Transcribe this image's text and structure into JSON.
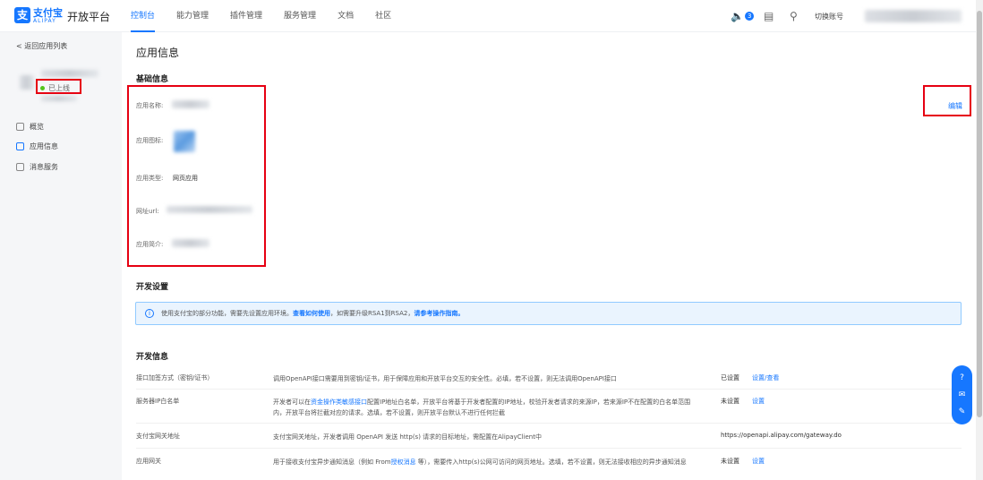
{
  "header": {
    "brand_glyph": "支",
    "brand_name": "支付宝",
    "brand_sub": "ALIPAY",
    "platform": "开放平台",
    "nav": [
      "控制台",
      "能力管理",
      "插件管理",
      "服务管理",
      "文档",
      "社区"
    ],
    "active_nav": "控制台",
    "notification_count": "3",
    "switch_account": "切换账号",
    "icons": [
      "speaker-icon",
      "document-icon",
      "search-icon"
    ]
  },
  "sidebar": {
    "back": "< 返回应用列表",
    "status": "已上线",
    "items": [
      "概览",
      "应用信息",
      "消息服务"
    ]
  },
  "main": {
    "title": "应用信息",
    "basic_title": "基础信息",
    "fields": {
      "name": "应用名称:",
      "icon": "应用图标:",
      "type": "应用类型:",
      "type_value": "网页应用",
      "url": "网址url:",
      "intro": "应用简介:"
    },
    "edit": "编辑",
    "dev_settings_title": "开发设置",
    "notice": {
      "text1": "使用支付宝的部分功能，需要先设置应用环境。",
      "link1": "查看如何使用",
      "text2": "，如需要升级RSA1到RSA2，",
      "link2": "请参考操作指南。"
    },
    "dev_info_title": "开发信息",
    "rows": [
      {
        "label": "接口加签方式（密钥/证书）",
        "desc": "调用OpenAPI接口需要用到密钥/证书，用于保障应用和开放平台交互的安全性。必填，若不设置，则无法调用OpenAPI接口",
        "status": "已设置",
        "action": "设置/查看"
      },
      {
        "label": "服务器IP白名单",
        "desc_pre": "开发者可以在",
        "desc_link": "资金操作类敏感接口",
        "desc_post": "配置IP地址白名单，开放平台将基于开发者配置的IP地址，校验开发者请求的来源IP，若来源IP不在配置的白名单范围内，开放平台将拦截对应的请求。选填，若不设置，则开放平台默认不进行任何拦截",
        "status": "未设置",
        "action": "设置"
      },
      {
        "label": "支付宝网关地址",
        "desc": "支付宝网关地址，开发者调用 OpenAPI 发送 http(s) 请求的目标地址，需配置在AlipayClient中",
        "status": "https://openapi.alipay.com/gateway.do",
        "action": ""
      },
      {
        "label": "应用网关",
        "desc_pre": "用于接收支付宝异步通知消息（例如 From",
        "desc_link": "授权消息",
        "desc_post": " 等），需要传入http(s)公网可访问的网页地址。选填，若不设置，则无法接收相应的异步通知消息",
        "status": "未设置",
        "action": "设置"
      }
    ]
  },
  "float_tools": [
    "question-icon",
    "chat-icon",
    "mail-icon"
  ]
}
